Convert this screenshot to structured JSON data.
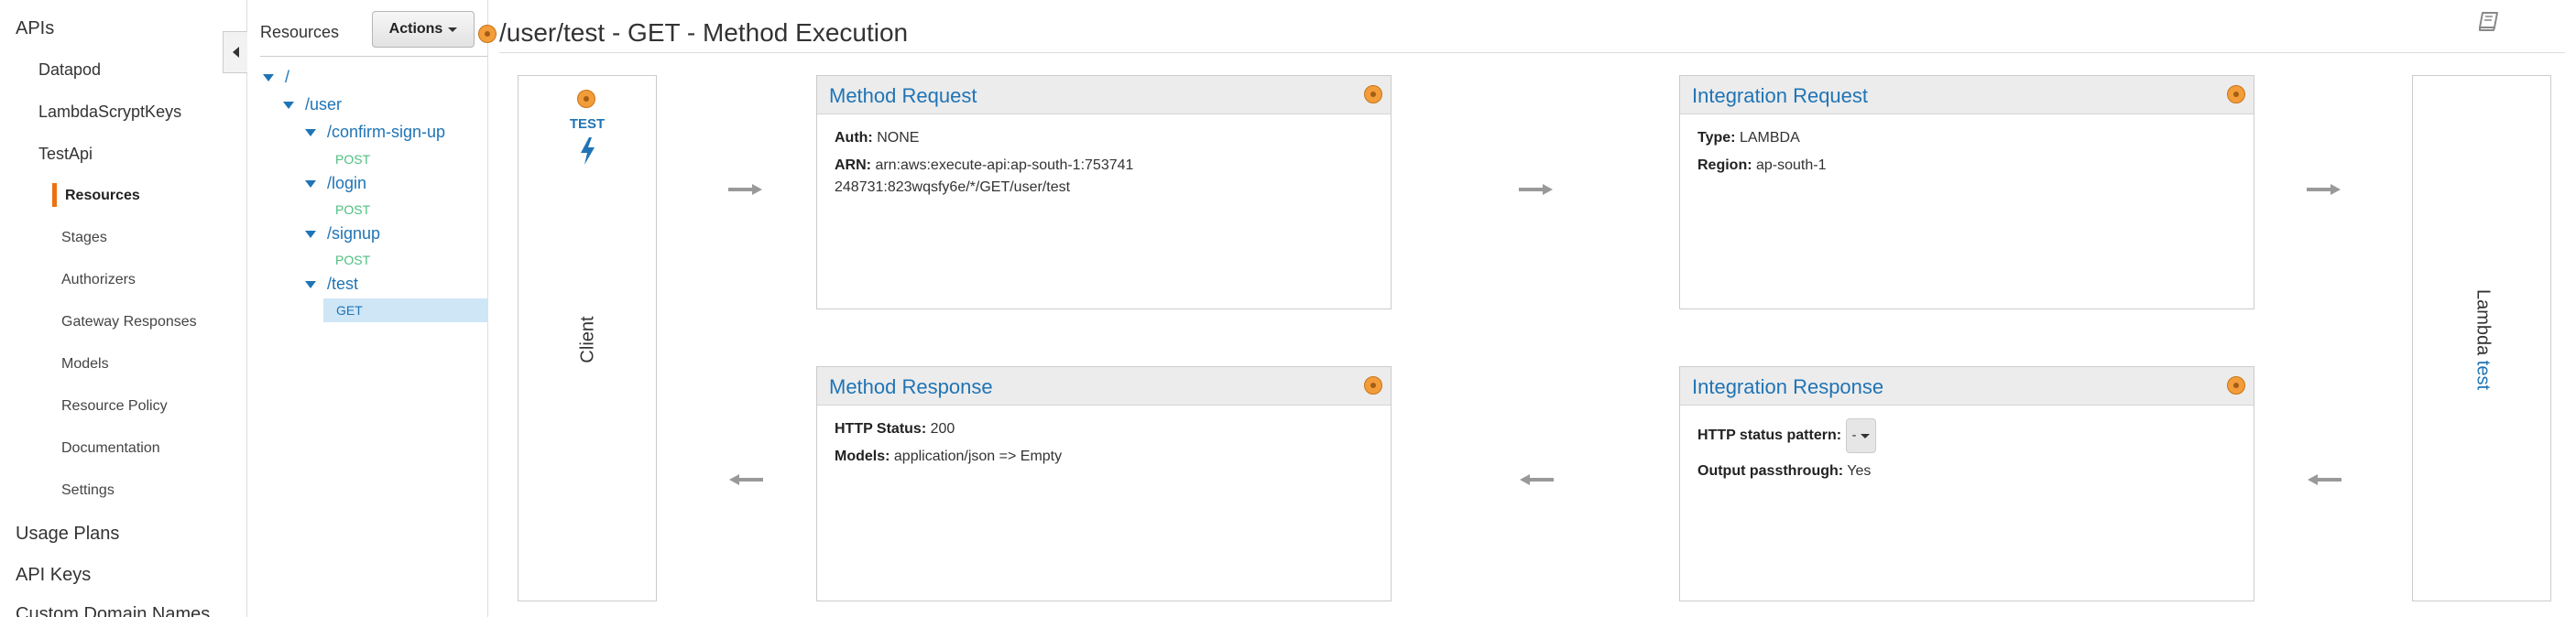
{
  "nav": {
    "top_items": [
      {
        "label": "APIs"
      },
      {
        "label": "Usage Plans"
      },
      {
        "label": "API Keys"
      },
      {
        "label": "Custom Domain Names"
      }
    ],
    "apis": [
      {
        "label": "Datapod"
      },
      {
        "label": "LambdaScryptKeys"
      },
      {
        "label": "TestApi"
      }
    ],
    "sub_items": [
      {
        "label": "Resources",
        "active": true
      },
      {
        "label": "Stages"
      },
      {
        "label": "Authorizers"
      },
      {
        "label": "Gateway Responses"
      },
      {
        "label": "Models"
      },
      {
        "label": "Resource Policy"
      },
      {
        "label": "Documentation"
      },
      {
        "label": "Settings"
      }
    ],
    "accent_color": "#ec7211"
  },
  "tree": {
    "title": "Resources",
    "actions_label": "Actions",
    "nodes": [
      {
        "label": "/"
      },
      {
        "label": "/user"
      },
      {
        "label": "/confirm-sign-up",
        "method": "POST"
      },
      {
        "label": "/login",
        "method": "POST"
      },
      {
        "label": "/signup",
        "method": "POST"
      },
      {
        "label": "/test",
        "method": "GET",
        "selected": true
      }
    ],
    "link_color": "#1f74b5",
    "post_color": "#4cbf7f"
  },
  "header": {
    "title": "/user/test - GET - Method Execution",
    "icon": "book-icon"
  },
  "client": {
    "test_label": "TEST",
    "label": "Client",
    "icon": "lightning-bolt-icon"
  },
  "lambda": {
    "prefix": "Lambda",
    "function": "test"
  },
  "method_request": {
    "title": "Method Request",
    "auth_label": "Auth:",
    "auth_value": "NONE",
    "arn_label": "ARN:",
    "arn_value": "arn:aws:execute-api:ap-south-1:753741248731:823wqsfy6e/*/GET/user/test"
  },
  "integration_request": {
    "title": "Integration Request",
    "type_label": "Type:",
    "type_value": "LAMBDA",
    "region_label": "Region:",
    "region_value": "ap-south-1"
  },
  "method_response": {
    "title": "Method Response",
    "status_label": "HTTP Status:",
    "status_value": "200",
    "models_label": "Models:",
    "models_value": "application/json => Empty"
  },
  "integration_response": {
    "title": "Integration Response",
    "pattern_label": "HTTP status pattern:",
    "pattern_value": "-",
    "passthrough_label": "Output passthrough:",
    "passthrough_value": "Yes"
  },
  "colors": {
    "link": "#1f74b5",
    "badge": "#f39c3a",
    "arrow": "#999999"
  }
}
